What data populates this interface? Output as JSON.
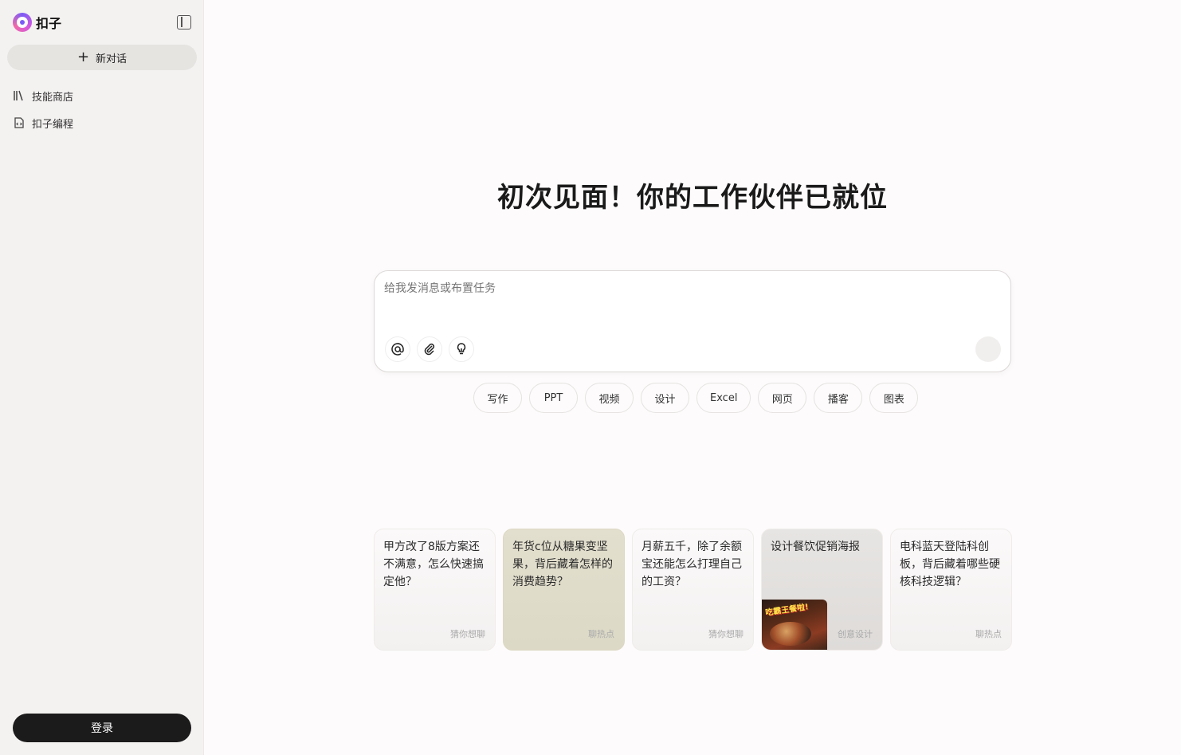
{
  "sidebar": {
    "brand": "扣子",
    "new_chat": "新对话",
    "items": [
      {
        "label": "技能商店",
        "icon": "library-icon"
      },
      {
        "label": "扣子编程",
        "icon": "code-file-icon"
      }
    ],
    "login": "登录"
  },
  "main": {
    "title": "初次见面！你的工作伙伴已就位",
    "composer": {
      "placeholder": "给我发消息或布置任务",
      "tools": [
        "at-icon",
        "paperclip-icon",
        "lightbulb-icon"
      ]
    },
    "chips": [
      "写作",
      "PPT",
      "视频",
      "设计",
      "Excel",
      "网页",
      "播客",
      "图表"
    ],
    "cards": [
      {
        "text": "甲方改了8版方案还不满意，怎么快速搞定他？",
        "tag": "猜你想聊"
      },
      {
        "text": "年货c位从糖果变坚果，背后藏着怎样的消费趋势？",
        "tag": "聊热点"
      },
      {
        "text": "月薪五千，除了余额宝还能怎么打理自己的工资？",
        "tag": "猜你想聊"
      },
      {
        "text": "设计餐饮促销海报",
        "tag": "创意设计",
        "poster_text": "吃霸王餐啦!"
      },
      {
        "text": "电科蓝天登陆科创板，背后藏着哪些硬核科技逻辑？",
        "tag": "聊热点"
      }
    ]
  }
}
